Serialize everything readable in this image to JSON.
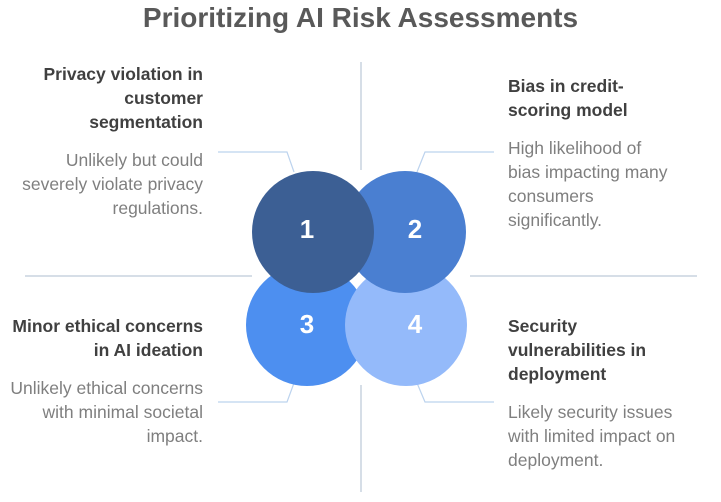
{
  "title": "Prioritizing AI Risk Assessments",
  "quadrants": [
    {
      "number": "1",
      "heading": "Privacy violation in customer segmentation",
      "description": "Unlikely but could severely violate privacy regulations.",
      "color": "#3c5f94"
    },
    {
      "number": "2",
      "heading": "Bias in credit-scoring model",
      "description": "High likelihood of bias impacting many consumers significantly.",
      "color": "#4a7fd1"
    },
    {
      "number": "3",
      "heading": "Minor ethical concerns in AI ideation",
      "description": "Unlikely ethical concerns with minimal societal impact.",
      "color": "#4d8ff0"
    },
    {
      "number": "4",
      "heading": "Security vulnerabilities in deployment",
      "description": "Likely security issues with limited impact on deployment.",
      "color": "#94bafa"
    }
  ],
  "colors": {
    "divider": "#c9d3df",
    "title": "#595959",
    "heading": "#404040",
    "description": "#7f7f7f"
  }
}
